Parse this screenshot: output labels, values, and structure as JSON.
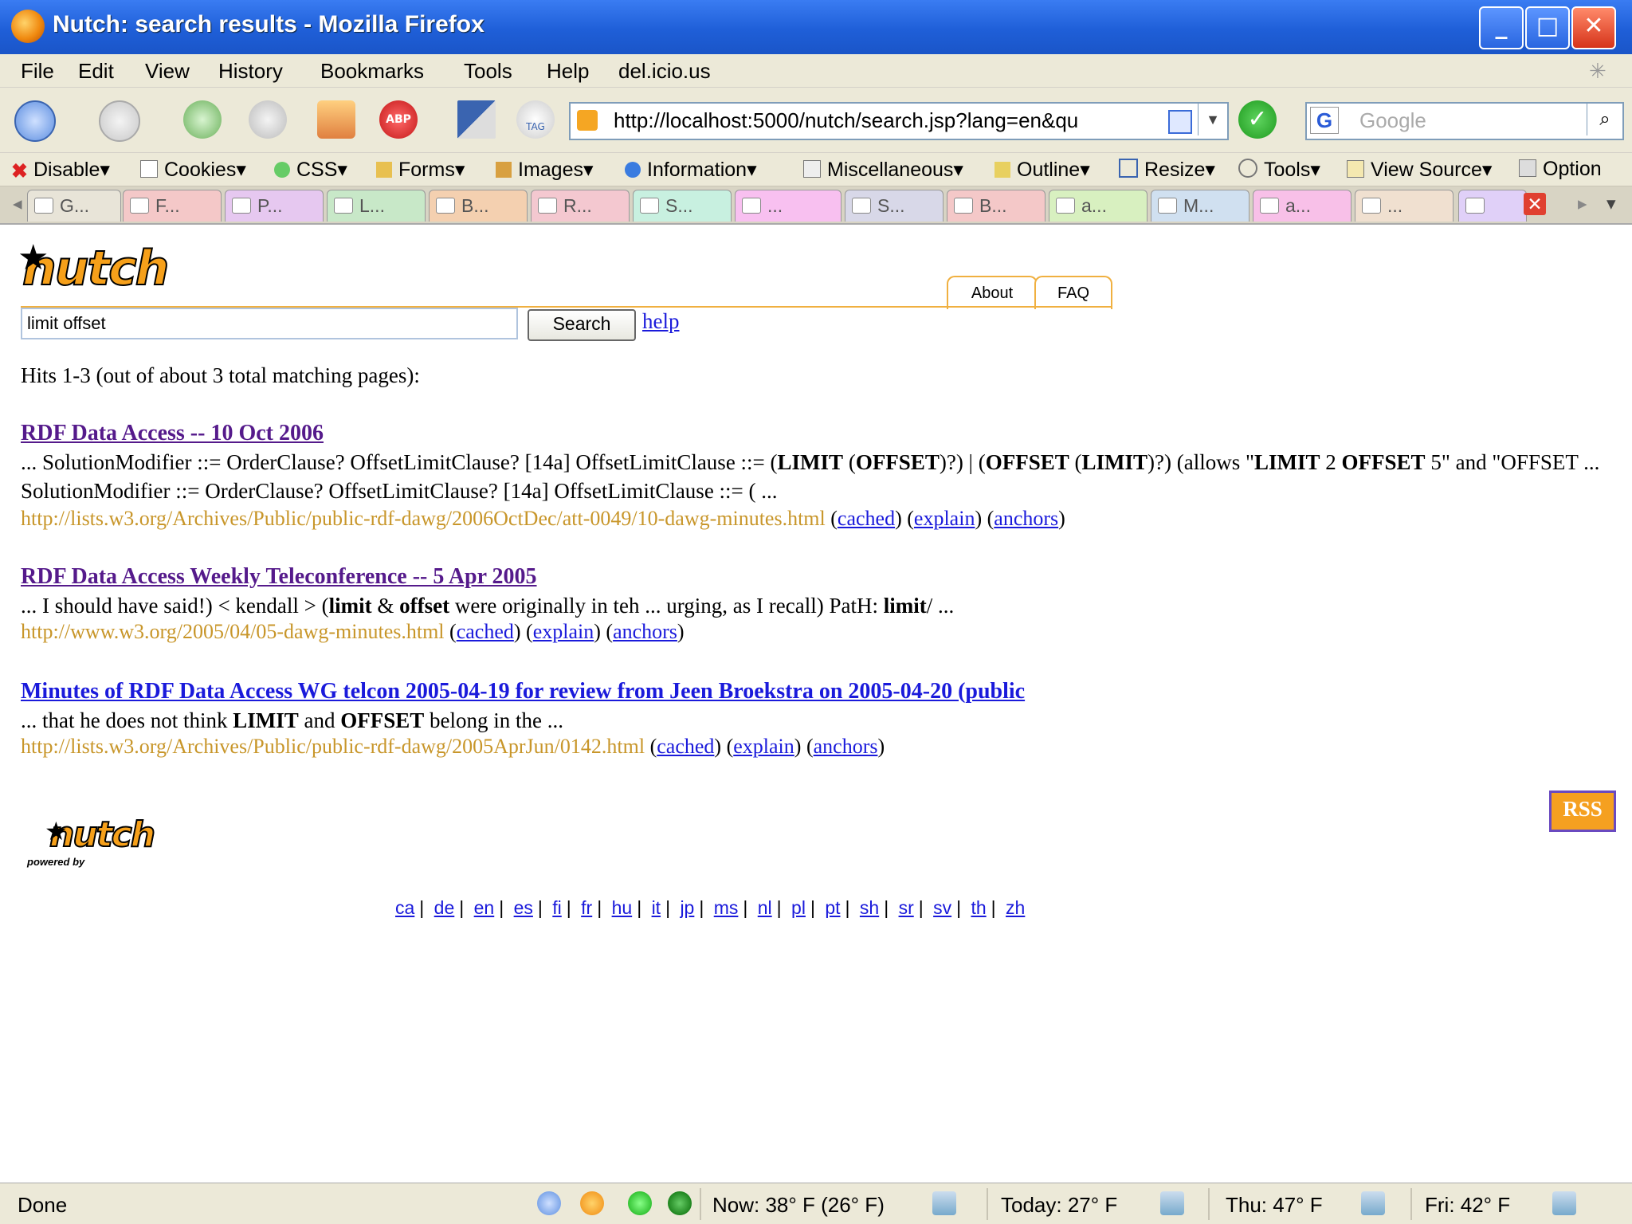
{
  "window": {
    "title": "Nutch: search results - Mozilla Firefox"
  },
  "menu": [
    "File",
    "Edit",
    "View",
    "History",
    "Bookmarks",
    "Tools",
    "Help",
    "del.icio.us"
  ],
  "navbar": {
    "url": "http://localhost:5000/nutch/search.jsp?lang=en&qu",
    "search_placeholder": "Google",
    "search_engine": "G"
  },
  "devbar": [
    "Disable",
    "Cookies",
    "CSS",
    "Forms",
    "Images",
    "Information",
    "Miscellaneous",
    "Outline",
    "Resize",
    "Tools",
    "View Source",
    "Option"
  ],
  "tabs": [
    "G...",
    "F...",
    "P...",
    "L...",
    "B...",
    "R...",
    "S...",
    "...",
    "S...",
    "B...",
    "a...",
    "M...",
    "a...",
    "..."
  ],
  "page": {
    "logo_text": "nutch",
    "about_tab": "About",
    "faq_tab": "FAQ",
    "query": "limit offset",
    "search_button": "Search",
    "help_link": "help",
    "hits_text": "Hits 1-3 (out of about 3 total matching pages):",
    "results": [
      {
        "title": "RDF Data Access -- 10 Oct 2006",
        "snippet_html": "... SolutionModifier ::= OrderClause? OffsetLimitClause? [14a] OffsetLimitClause ::= (<b>LIMIT</b> (<b>OFFSET</b>)?) | (<b>OFFSET</b> (<b>LIMIT</b>)?) (allows \"<b>LIMIT</b> 2 <b>OFFSET</b> 5\" and \"OFFSET ... SolutionModifier ::= OrderClause? OffsetLimitClause? [14a] OffsetLimitClause ::= ( ...",
        "url": "http://lists.w3.org/Archives/Public/public-rdf-dawg/2006OctDec/att-0049/10-dawg-minutes.html"
      },
      {
        "title": "RDF Data Access Weekly Teleconference -- 5 Apr 2005",
        "snippet_html": "... I should have said!) &lt; kendall &gt; (<b>limit</b> &amp; <b>offset</b> were originally in teh ... urging, as I recall) PatH: <b>limit</b>/ ...",
        "url": "http://www.w3.org/2005/04/05-dawg-minutes.html"
      },
      {
        "title": "Minutes of RDF Data Access WG telcon 2005-04-19 for review from Jeen Broekstra on 2005-04-20 (public",
        "snippet_html": "... that he does not think <b>LIMIT</b> and <b>OFFSET</b> belong in the ...",
        "url": "http://lists.w3.org/Archives/Public/public-rdf-dawg/2005AprJun/0142.html"
      }
    ],
    "link_cached": "cached",
    "link_explain": "explain",
    "link_anchors": "anchors",
    "rss_label": "RSS",
    "powered_by": "powered by",
    "languages": [
      "ca",
      "de",
      "en",
      "es",
      "fi",
      "fr",
      "hu",
      "it",
      "jp",
      "ms",
      "nl",
      "pl",
      "pt",
      "sh",
      "sr",
      "sv",
      "th",
      "zh"
    ]
  },
  "status": {
    "text": "Done",
    "weather_now": "Now: 38° F (26° F)",
    "weather_today": "Today: 27° F",
    "weather_thu": "Thu: 47° F",
    "weather_fri": "Fri: 42° F"
  },
  "colors": {
    "title_bar": "#1f5fd8",
    "chrome": "#ece9d8",
    "link": "#1a1adb",
    "visited": "#551a8b",
    "url_green": "#c8962a",
    "nutch_orange": "#f6a01a"
  }
}
